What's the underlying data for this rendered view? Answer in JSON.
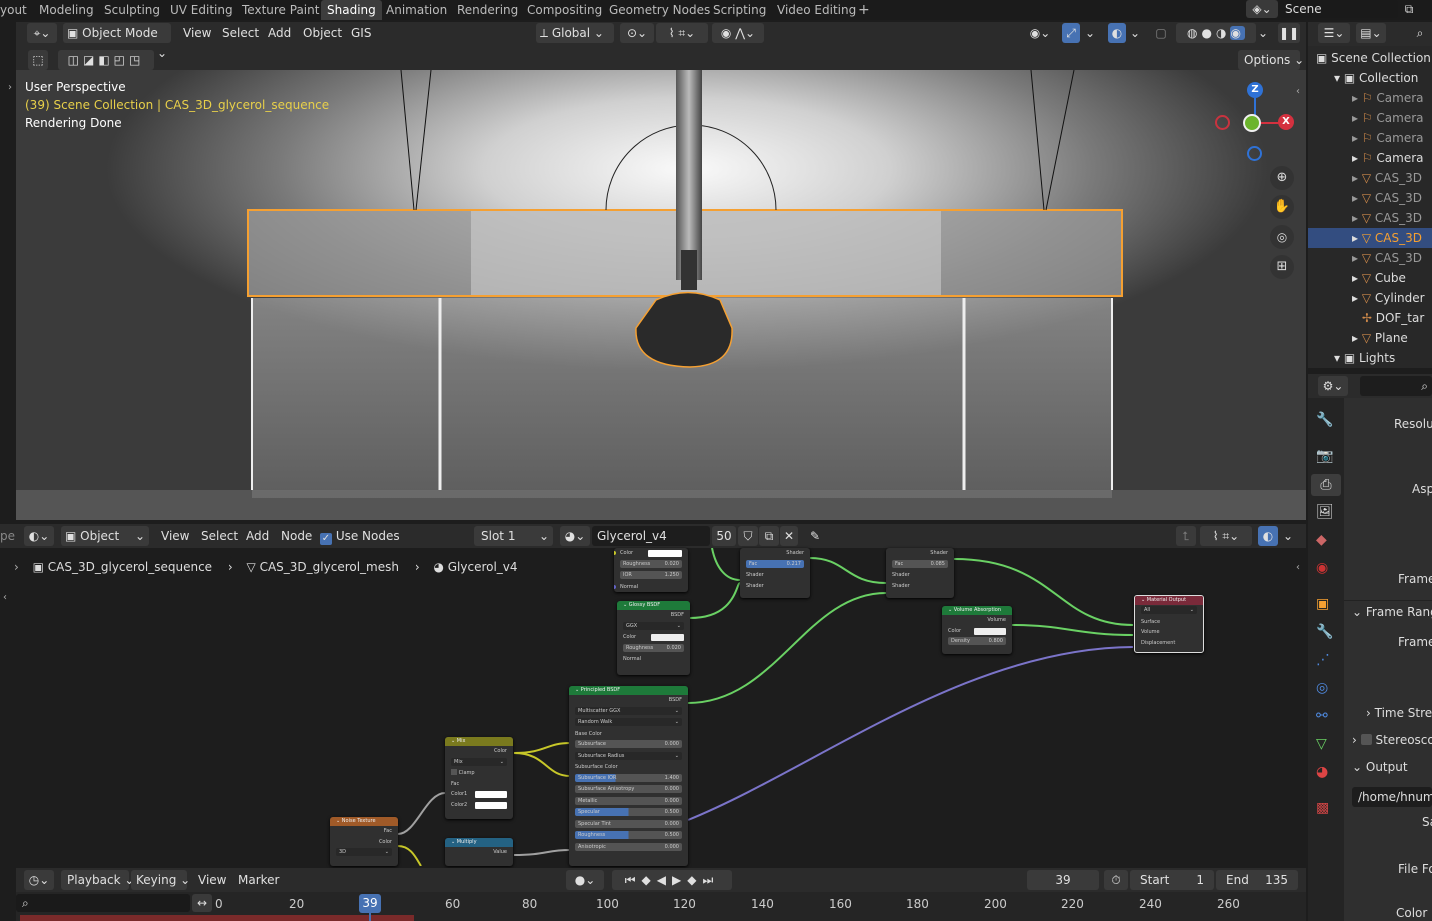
{
  "workspace_tabs": [
    "yout",
    "Modeling",
    "Sculpting",
    "UV Editing",
    "Texture Paint",
    "Shading",
    "Animation",
    "Rendering",
    "Compositing",
    "Geometry Nodes",
    "Scripting",
    "Video Editing"
  ],
  "scene_name": "Scene",
  "viewport": {
    "mode": "Object Mode",
    "menus": [
      "View",
      "Select",
      "Add",
      "Object",
      "GIS"
    ],
    "orientation": "Global",
    "options": "Options",
    "overlay_title": "User Perspective",
    "overlay_collection": "(39) Scene Collection | CAS_3D_glycerol_sequence",
    "overlay_status": "Rendering Done",
    "gizmo": {
      "z": "Z",
      "x": "X"
    }
  },
  "outliner": {
    "root": "Scene Collection",
    "collection": "Collection",
    "items": [
      "Camera",
      "Camera",
      "Camera",
      "Camera",
      "CAS_3D",
      "CAS_3D",
      "CAS_3D",
      "CAS_3D",
      "CAS_3D",
      "Cube",
      "Cylinder",
      "DOF_tar",
      "Plane"
    ],
    "lights": "Lights"
  },
  "properties": {
    "labels": [
      "Resolut",
      "Asp",
      "Frame",
      "Frame Range",
      "Frame",
      "Time Stret",
      "Stereoscop",
      "Output",
      "Sa",
      "File Fo",
      "Color D"
    ],
    "output_path": "/home/hnum/C"
  },
  "node_editor": {
    "editor_type": "Object",
    "menus": [
      "View",
      "Select",
      "Add",
      "Node"
    ],
    "use_nodes": "Use Nodes",
    "slot": "Slot 1",
    "material": "Glycerol_v4",
    "users": "50",
    "breadcrumb": [
      "CAS_3D_glycerol_sequence",
      "CAS_3D_glycerol_mesh",
      "Glycerol_v4"
    ]
  },
  "nodes": {
    "top_partial": {
      "rows": [
        "Color",
        "Roughness",
        "IOR",
        "Normal"
      ],
      "values": [
        "",
        "0.020",
        "1.250",
        ""
      ]
    },
    "glossy": {
      "title": "Glossy BSDF",
      "out": "BSDF",
      "dist": "GGX",
      "rows": [
        "Color",
        "Roughness",
        "Normal"
      ],
      "rough": "0.020"
    },
    "mix1": {
      "out": "Shader",
      "fac": "Fac",
      "fac_val": "0.217",
      "rows": [
        "Shader",
        "Shader"
      ]
    },
    "mix2": {
      "out": "Shader",
      "fac": "Fac",
      "fac_val": "0.085",
      "rows": [
        "Shader",
        "Shader"
      ]
    },
    "volume": {
      "title": "Volume Absorption",
      "out": "Volume",
      "rows": [
        "Color",
        "Density"
      ],
      "density": "0.800"
    },
    "output": {
      "title": "Material Output",
      "target": "All",
      "rows": [
        "Surface",
        "Volume",
        "Displacement"
      ]
    },
    "principled": {
      "title": "Principled BSDF",
      "out": "BSDF",
      "dist": "Multiscatter GGX",
      "sss": "Random Walk",
      "rows": [
        "Base Color",
        "Subsurface",
        "Subsurface Radius",
        "Subsurface Color",
        "Subsurface IOR",
        "Subsurface Anisotropy",
        "Metallic",
        "Specular",
        "Specular Tint",
        "Roughness",
        "Anisotropic"
      ],
      "values": [
        "",
        "0.000",
        "",
        "",
        "1.400",
        "0.000",
        "0.000",
        "0.500",
        "0.000",
        "0.500",
        "0.000"
      ]
    },
    "mixrgb": {
      "title": "Mix",
      "out": "Color",
      "blend": "Mix",
      "clamp": "Clamp",
      "rows": [
        "Fac",
        "Color1",
        "Color2"
      ]
    },
    "noise": {
      "title": "Noise Texture",
      "rows": [
        "Fac",
        "Color"
      ],
      "dim": "3D"
    },
    "multiply": {
      "title": "Multiply",
      "out": "Value"
    }
  },
  "timeline": {
    "menus": [
      "Playback",
      "Keying",
      "View",
      "Marker"
    ],
    "current_frame": "39",
    "start_label": "Start",
    "start": "1",
    "end_label": "End",
    "end": "135",
    "ticks": [
      "0",
      "20",
      "39",
      "60",
      "80",
      "100",
      "120",
      "140",
      "160",
      "180",
      "200",
      "220",
      "240",
      "260"
    ]
  },
  "colors": {
    "accent": "#4772b3",
    "selected": "#f5a032",
    "overlay_yellow": "#e8d04a",
    "green_link": "#6ad164",
    "purple_link": "#7b74c9"
  }
}
